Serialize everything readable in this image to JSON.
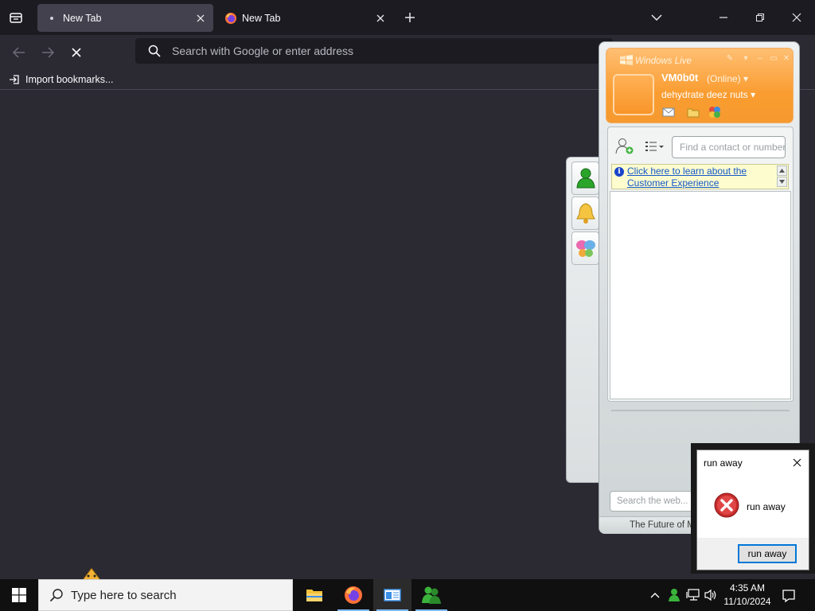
{
  "browser": {
    "tabs": [
      {
        "title": "New Tab",
        "active": true
      },
      {
        "title": "New Tab",
        "active": false
      }
    ],
    "urlbar_placeholder": "Search with Google or enter address",
    "bookmarks": [
      {
        "label": "Import bookmarks..."
      }
    ]
  },
  "msn": {
    "title": "Windows Live",
    "username": "VM0b0t",
    "status": "(Online)",
    "personal_message": "dehydrate deez nuts",
    "find_placeholder": "Find a contact or number",
    "info_link": "Click here to learn about the Customer Experience",
    "web_search_placeholder": "Search the web...",
    "footer_text": "The Future of MS"
  },
  "dialog": {
    "title": "run away",
    "message": "run away",
    "button": "run away"
  },
  "taskbar": {
    "search_placeholder": "Type here to search",
    "time": "4:35 AM",
    "date": "11/10/2024"
  },
  "colors": {
    "browser_bg": "#2b2a33",
    "tabbar_bg": "#1c1b22",
    "msn_orange": "#fa9d31",
    "dialog_accent": "#0078d7"
  }
}
